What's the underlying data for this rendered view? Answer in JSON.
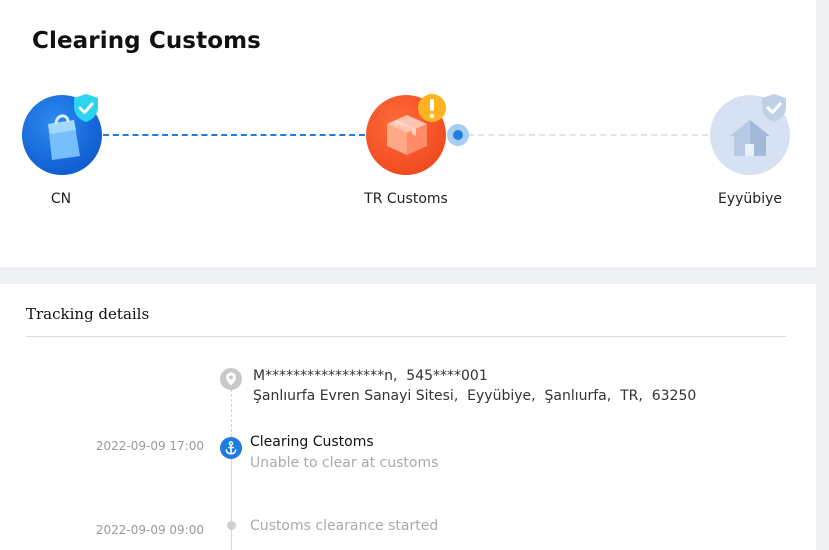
{
  "header": {
    "status_title": "Clearing Customs"
  },
  "route": {
    "nodes": [
      {
        "label": "CN",
        "icon": "shopping-bag-icon",
        "badge": "check-shield-icon",
        "state": "completed"
      },
      {
        "label": "TR Customs",
        "icon": "package-box-icon",
        "badge": "exclamation-icon",
        "state": "current-warning"
      },
      {
        "label": "Eyyübiye",
        "icon": "house-icon",
        "badge": "check-shield-icon",
        "state": "pending"
      }
    ]
  },
  "tracking": {
    "title": "Tracking details",
    "recipient": {
      "line1": "M*****************n,  545****001",
      "line2": "Şanlıurfa Evren Sanayi Sitesi,  Eyyübiye,  Şanlıurfa,  TR,  63250",
      "icon": "location-pin-icon"
    },
    "events": [
      {
        "time": "2022-09-09 17:00",
        "title": "Clearing Customs",
        "detail": "Unable to clear at customs",
        "icon": "anchor-icon"
      },
      {
        "time": "2022-09-09 09:00",
        "title": "Customs clearance started",
        "detail": ""
      }
    ]
  },
  "colors": {
    "accent": "#1f7de0",
    "warning": "#f24d22",
    "badge_yellow": "#ffb41f",
    "pending": "#d6e2f3"
  }
}
